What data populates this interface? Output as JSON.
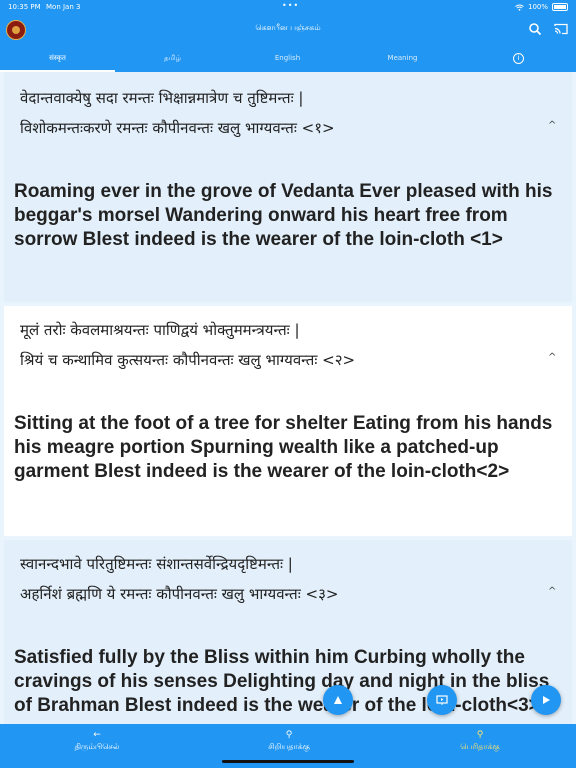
{
  "status": {
    "time": "10:35 PM",
    "date": "Mon Jan 3",
    "battery": "100%"
  },
  "app": {
    "title": "கௌபீன பஞ்சகம்"
  },
  "tabs": [
    {
      "label": "संस्कृत"
    },
    {
      "label": "தமிழ்"
    },
    {
      "label": "English"
    },
    {
      "label": "Meaning"
    },
    {
      "label": "ⓘ"
    }
  ],
  "verses": [
    {
      "line1": "वेदान्तवाक्येषु सदा रमन्तः भिक्षान्नमात्रेण च तुष्टिमन्तः  |",
      "line2": "विशोकमन्तःकरणे रमन्तः कौपीनवन्तः खलु भाग्यवन्तः <१>",
      "meaning": "Roaming ever in the grove of Vedanta Ever pleased with his beggar's morsel Wandering onward his heart free from sorrow Blest indeed is the wearer of the loin-cloth  <1>"
    },
    {
      "line1": "मूलं तरोः केवलमाश्रयन्तः पाणिद्वयं भोक्तुममन्त्रयन्तः  |",
      "line2": "श्रियं च कन्थामिव कुत्सयन्तः कौपीनवन्तः खलु भाग्यवन्तः <२>",
      "meaning": "Sitting at the foot of a tree for shelter Eating from his hands his meagre portion Spurning wealth like a patched-up garment Blest indeed is the wearer of the loin-cloth<2>"
    },
    {
      "line1": "स्वानन्दभावे परितुष्टिमन्तः संशान्तसर्वेन्द्रियदृष्टिमन्तः  |",
      "line2": "अहर्निशं ब्रह्मणि ये रमन्तः कौपीनवन्तः खलु भाग्यवन्तः  <३>",
      "meaning": "Satisfied fully by the Bliss within him Curbing wholly the cravings of his senses Delighting day and night in the bliss of Brahman Blest indeed is the wearer of the loin-cloth<3>"
    }
  ],
  "bottom_nav": {
    "back": "திரும்பிசெல்",
    "zoom_out": "சிறியதாக்கு",
    "zoom_in": "பெரிதாக்கு"
  },
  "icons": {
    "logo": "app-logo",
    "search": "search-icon",
    "cast": "cast-icon",
    "expand": "chevron-up-icon"
  },
  "colors": {
    "accent": "#2196f3",
    "card_alt": "#e3f0fb"
  }
}
